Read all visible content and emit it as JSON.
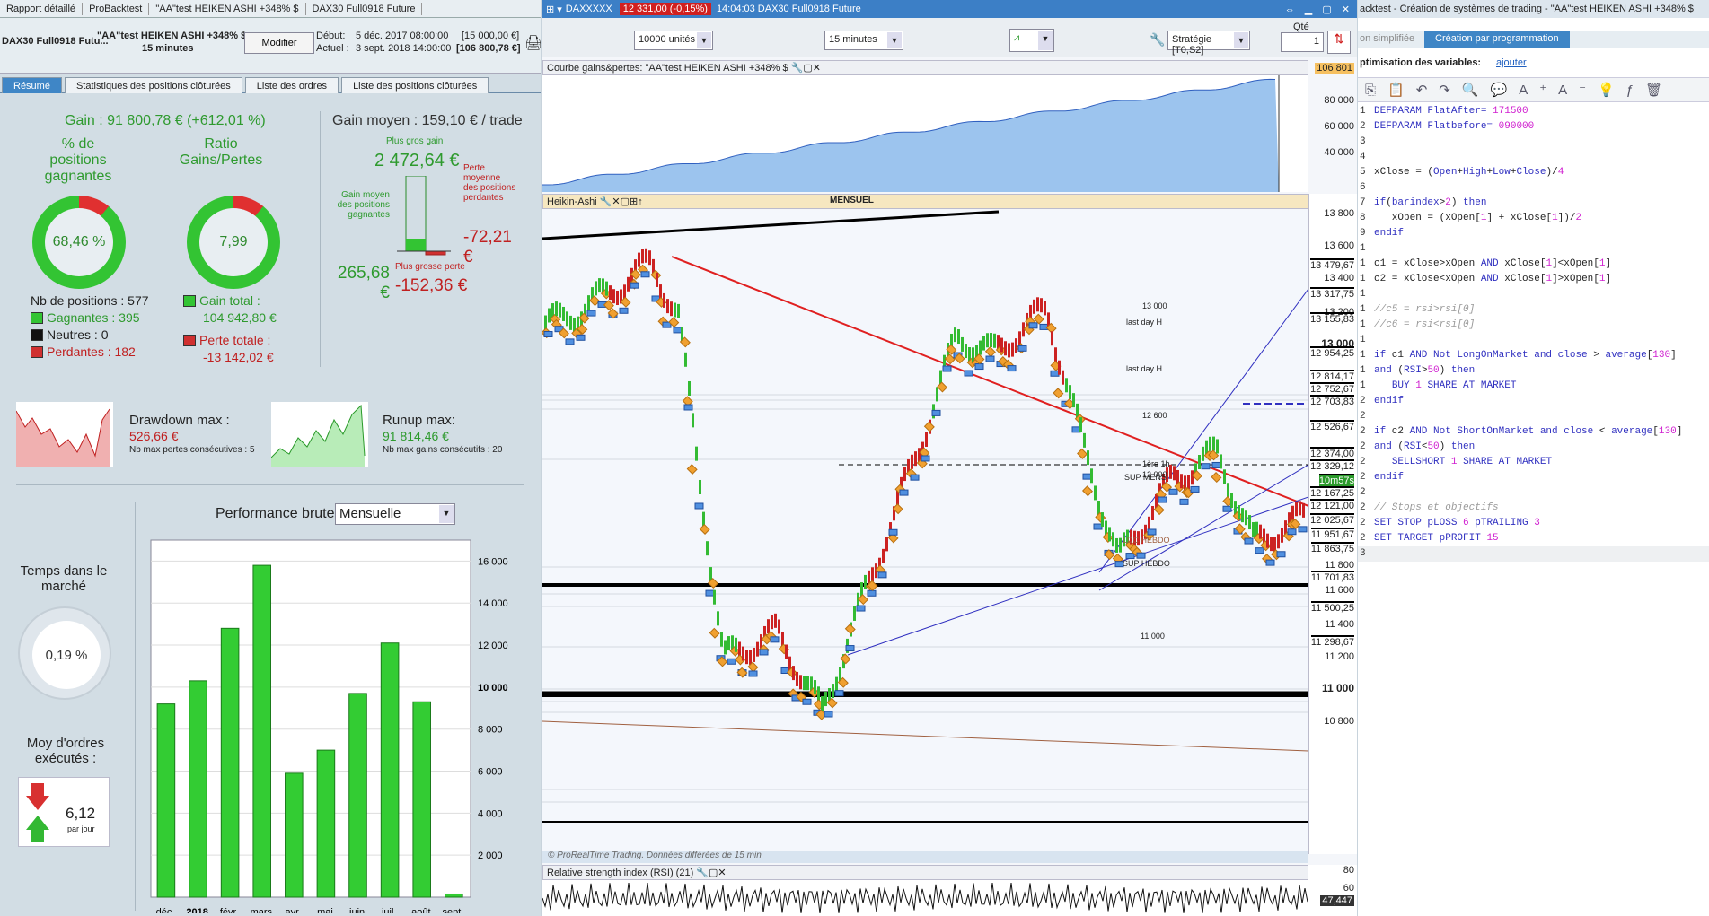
{
  "left": {
    "titlebar": [
      "Rapport détaillé",
      "ProBacktest",
      "\"AA\"test HEIKEN ASHI +348% $",
      "DAX30 Full0918 Future"
    ],
    "instrument": "DAX30 Full0918 Futu...",
    "strategy": "\"AA\"test HEIKEN ASHI +348% $",
    "timeframe": "15 minutes",
    "modify": "Modifier",
    "debut_label": "Début:",
    "debut_date": "5 déc. 2017 08:00:00",
    "debut_val": "[15 000,00 €]",
    "actuel_label": "Actuel :",
    "actuel_date": "3 sept. 2018 14:00:00",
    "actuel_val": "[106 800,78 €]",
    "tabs": [
      "Résumé",
      "Statistiques des positions clôturées",
      "Liste des ordres",
      "Liste des positions clôturées"
    ],
    "gain": "Gain : 91 800,78 € (+612,01 %)",
    "pct_title": "% de positions gagnantes",
    "pct_value": "68,46 %",
    "pct_frac": 0.6846,
    "ratio_title": "Ratio Gains/Pertes",
    "ratio_value": "7,99",
    "nb_pos": "Nb de positions : 577",
    "gagnantes": "Gagnantes : 395",
    "neutres": "Neutres : 0",
    "perdantes": "Perdantes : 182",
    "gain_total_label": "Gain total :",
    "gain_total": "104 942,80 €",
    "perte_totale_label": "Perte totale :",
    "perte_totale": "-13 142,02 €",
    "gain_moyen": "Gain moyen : 159,10 € / trade",
    "plus_gros_gain_label": "Plus gros gain",
    "plus_gros_gain": "2 472,64 €",
    "gain_moyen_pos_label": "Gain moyen des positions gagnantes",
    "gain_moyen_pos": "265,68 €",
    "perte_moy_label": "Perte moyenne des positions perdantes",
    "perte_moy": "-72,21 €",
    "plus_grosse_perte_label": "Plus grosse perte",
    "plus_grosse_perte": "-152,36 €",
    "drawdown_label": "Drawdown max :",
    "drawdown": "526,66 €",
    "nb_max_pertes": "Nb max pertes consécutives : 5",
    "runup_label": "Runup max:",
    "runup": "91 814,46 €",
    "nb_max_gains": "Nb max gains consécutifs : 20",
    "temps_label": "Temps dans le marché",
    "temps_value": "0,19 %",
    "moy_ordres_label": "Moy d'ordres exécutés :",
    "moy_ordres_value": "6,12",
    "par_jour": "par jour",
    "perf_label": "Performance brute",
    "perf_select": "Mensuelle"
  },
  "chart_data": {
    "type": "bar",
    "title": "Performance brute",
    "categories": [
      "déc.",
      "2018",
      "févr.",
      "mars",
      "avr.",
      "mai",
      "juin",
      "juil.",
      "août",
      "sept."
    ],
    "values": [
      9200,
      10300,
      12800,
      15800,
      5900,
      7000,
      9700,
      12100,
      9300,
      150
    ],
    "ylim": [
      0,
      17000
    ],
    "yticks": [
      "2 000",
      "4 000",
      "6 000",
      "8 000",
      "10 000",
      "12 000",
      "14 000",
      "16 000"
    ],
    "bar_color": "#33cc33"
  },
  "mid": {
    "symbol": "DAXXXXX",
    "price": "12 331,00 (-0,15%)",
    "time": "14:04:03 DAX30 Full0918 Future",
    "units": "10000 unités",
    "tf": "15 minutes",
    "strategy_sel": "Stratégie [T0,S2]",
    "qty_label": "Qté",
    "qty": "1",
    "equity_header": "Courbe gains&pertes: \"AA\"test HEIKEN ASHI +348% $",
    "equity_axis": [
      "106 801",
      "80 000",
      "60 000",
      "40 000"
    ],
    "ha_header": "Heikin-Ashi",
    "mensuel": "MENSUEL",
    "price_axis": [
      "13 800",
      "13 600",
      "13 479,67",
      "13 400",
      "13 317,75",
      "13 200",
      "13 155,83",
      "13 000",
      "12 954,25",
      "12 814,17",
      "12 752,67",
      "12 703,83",
      "12 526,67",
      "12 374,00",
      "12 329,12",
      "10m57s",
      "12 167,25",
      "12 121,00",
      "12 025,67",
      "11 951,67",
      "11 863,75",
      "11 800",
      "11 701,83",
      "11 600",
      "11 500,25",
      "11 400",
      "11 298,67",
      "11 200",
      "11 000",
      "10 800"
    ],
    "labels": [
      "13 000",
      "12 600",
      "12 000",
      "last day H",
      "SUP MENS",
      "LDC HEBDO",
      "SUP HEBDO",
      "11 000",
      "1ère 1h",
      "last day H"
    ],
    "footer": "© ProRealTime Trading. Données différées de 15 min",
    "rsi_header": "Relative strength index (RSI) (21)",
    "rsi_axis": [
      "80",
      "60",
      "47,447"
    ]
  },
  "right": {
    "title": "acktest - Création de systèmes de trading - \"AA\"test HEIKEN ASHI +348% $",
    "tab_simple": "on simplifiée",
    "tab_prog": "Création par programmation",
    "opt_label": "ptimisation des variables:",
    "opt_link": "ajouter"
  }
}
